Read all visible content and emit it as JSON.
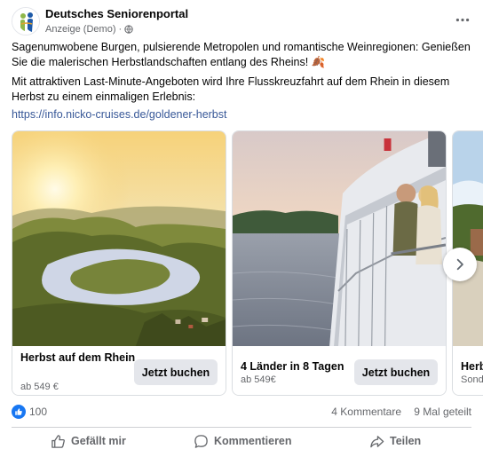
{
  "post": {
    "page_name": "Deutsches Seniorenportal",
    "sponsored_label": "Anzeige (Demo)",
    "separator": "·",
    "paragraph1": "Sagenumwobene Burgen, pulsierende Metropolen und romantische Weinregionen: Genießen Sie die malerischen Herbstlandschaften entlang des Rheins! 🍂",
    "paragraph2": "Mit attraktiven Last-Minute-Angeboten wird Ihre Flusskreuzfahrt auf dem Rhein in diesem Herbst zu einem einmaligen Erlebnis:",
    "link": "https://info.nicko-cruises.de/goldener-herbst"
  },
  "carousel": {
    "cards": [
      {
        "title": "Herbst auf dem Rhein",
        "subtitle": "ab 549 €",
        "cta": "Jetzt buchen"
      },
      {
        "title": "4 Länder in 8 Tagen",
        "subtitle": "ab 549€",
        "cta": "Jetzt buchen"
      },
      {
        "title": "Herb",
        "subtitle": "Sond"
      }
    ]
  },
  "stats": {
    "likes": "100",
    "comments": "4 Kommentare",
    "shares": "9 Mal geteilt"
  },
  "actions": {
    "like": "Gefällt mir",
    "comment": "Kommentieren",
    "share": "Teilen"
  },
  "icons": {
    "avatar": "seniorenportal-logo",
    "globe": "globe-icon",
    "more": "more-dots-icon",
    "next": "chevron-right-icon",
    "like_badge": "thumbs-up-icon",
    "like_action": "thumbs-up-outline-icon",
    "comment_action": "speech-bubble-icon",
    "share_action": "share-arrow-icon"
  },
  "colors": {
    "link": "#385898",
    "like_blue": "#1877f2",
    "secondary_text": "#65676b",
    "button_bg": "#e4e6eb"
  }
}
